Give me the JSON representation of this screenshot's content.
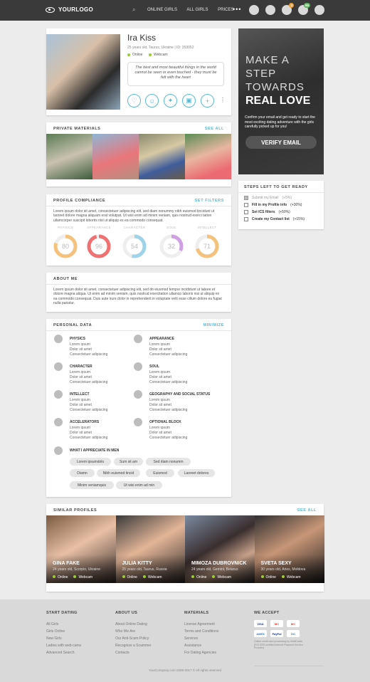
{
  "header": {
    "logo": "YOURLOGO",
    "nav": [
      "ONLINE GIRLS",
      "ALL GIRLS",
      "PRICES"
    ],
    "more": "•••",
    "badges": {
      "notifications": "3",
      "credits": "65"
    }
  },
  "profile": {
    "name": "Ira Kiss",
    "meta": "25 years old, Taurus, Ukraine | ID: 353052",
    "status_online": "Online",
    "status_webcam": "Webcam",
    "quote": "The best and most beautiful things in the world cannot be seen or even touched - they must be felt with the heart"
  },
  "private": {
    "title": "PRIVATE MATERIALS",
    "link": "SEE ALL"
  },
  "compliance": {
    "title": "PROFILE COMPLIANCE",
    "link": "SET FILTERS",
    "text": "Lorem ipsum dolor sit amet, consectetuer adipiscing elit, sed diam nonummy nibh euismod tincidunt ut laoreet dolore magna aliquam erat volutpat. Ut wisi enim ad minim veniam, quis nostrud exerci tation ullamcorper suscipit lobortis nisl ut aliquip ex ea commodo consequat.",
    "metrics": [
      {
        "label": "PHYSICS",
        "value": "80",
        "pct": 80,
        "color": "#f4c27c"
      },
      {
        "label": "APPEARANCE",
        "value": "96",
        "pct": 96,
        "color": "#f07171"
      },
      {
        "label": "CHARACTER",
        "value": "54",
        "pct": 54,
        "color": "#9fd3ea"
      },
      {
        "label": "SOUL",
        "value": "32",
        "pct": 32,
        "color": "#cfa0e4"
      },
      {
        "label": "INTELLECT",
        "value": "71",
        "pct": 71,
        "color": "#f4c27c"
      }
    ]
  },
  "about": {
    "title": "ABOUT ME",
    "text": "Lorem ipsum dolor sit amet, consectetuer adipiscing elit, sed do eiusmod tempor incididunt ut labore et dolore magna aliqua. Ut enim ad minim veniam, quis nostrud exercitation ullamco laboris nisi ut aliquip ex ea commodo consequat. Duis aute irure dolor in reprehenderit in voluptate velit esse cillum dolore eu fugiat nulla pariatur."
  },
  "personal": {
    "title": "PERSONAL DATA",
    "link": "MINIMIZE",
    "blocks": [
      {
        "head": "PHYSICS",
        "l1": "Lorem ipsum",
        "l2": "Dolor sit amet",
        "l3": "Consectetuer adipiscing"
      },
      {
        "head": "APPEARANCE",
        "l1": "Lorem ipsum",
        "l2": "Dolor sit amet",
        "l3": "Consectetuer adipiscing"
      },
      {
        "head": "CHARACTER",
        "l1": "Lorem ipsum",
        "l2": "Dolor sit amet",
        "l3": "Consectetuer adipiscing"
      },
      {
        "head": "SOUL",
        "l1": "Lorem ipsum",
        "l2": "Dolor sit amet",
        "l3": "Consectetuer adipiscing"
      },
      {
        "head": "INTELLECT",
        "l1": "Lorem ipsum",
        "l2": "Dolor sit amet",
        "l3": "Consectetuer adipiscing"
      },
      {
        "head": "GEOGRAPHY AND SOCIAL STATUS",
        "l1": "Lorem ipsum",
        "l2": "Dolor sit amet",
        "l3": "Consectetuer adipiscing"
      },
      {
        "head": "ACCELERATORS",
        "l1": "Lorem ipsum",
        "l2": "Dolor sit amet",
        "l3": "Consectetuer adipiscing"
      },
      {
        "head": "OPTIONAL BLOCK",
        "l1": "Lorem ipsum",
        "l2": "Dolor sit amet",
        "l3": "Consectetuer adipiscing"
      }
    ],
    "appreciate": "WHAT I APPRECIATE IN MEN",
    "tags": [
      "Lorem ipsumdolo",
      "Sum sit am",
      "Sed diam nonumm",
      "Diamn",
      "Nibh euismod tincid",
      "Euismod",
      "Laoreet dolores",
      "Minim veniamquis",
      "Ut wisi enim ad min"
    ]
  },
  "similar": {
    "title": "SIMILAR PROFILES",
    "link": "SEE ALL",
    "items": [
      {
        "name": "GINA FAKE",
        "sub": "24 years old, Scorpio, Ukraine",
        "online": "Online",
        "webcam": "Webcam"
      },
      {
        "name": "JULIA KITTY",
        "sub": "25 years old, Taurus, Russia",
        "online": "Online",
        "webcam": "Webcam"
      },
      {
        "name": "MIMOZA DUBROVNICK",
        "sub": "24 years old, Gemini, Belarus",
        "online": "Online",
        "webcam": "Webcam"
      },
      {
        "name": "SVETA SEXY",
        "sub": "30 years old, Aries, Moldova",
        "online": "Online",
        "webcam": "Webcam"
      }
    ]
  },
  "promo": {
    "l1": "MAKE A",
    "l2": "STEP",
    "l3": "TOWARDS",
    "l4": "REAL LOVE",
    "text": "Confirm your email and get ready to start the most exciting dating adventure with the girls carefully picked up for you!",
    "button": "VERIFY EMAIL"
  },
  "steps": {
    "title": "STEPS LEFT TO GET READY",
    "items": [
      {
        "label": "Submit my Email",
        "bonus": "(+5%)"
      },
      {
        "label": "Fill in my Profile info",
        "bonus": "(+30%)"
      },
      {
        "label": "Set ICS filters",
        "bonus": "(+50%)"
      },
      {
        "label": "Create my Contact list",
        "bonus": "(+15%)"
      }
    ]
  },
  "footer": {
    "c1": {
      "h": "START DATING",
      "links": [
        "All Girls",
        "Girls Online",
        "New Girls",
        "Ladies with web-cams",
        "Advanced Search"
      ]
    },
    "c2": {
      "h": "ABOUT US",
      "links": [
        "About Online Dating",
        "Who We Are",
        "Our Anti-Scam Policy",
        "Recognize a Scammer",
        "Contacts"
      ]
    },
    "c3": {
      "h": "MATERIALS",
      "links": [
        "License Agreement",
        "Terms and Conditions",
        "Services",
        "Assistance",
        "For Dating Agencies"
      ]
    },
    "c4": {
      "h": "WE ACCEPT",
      "note": "Online credit card processing by MultiCards (PCI DSS certified Internet Payment Service Provider)",
      "cards": [
        "VISA",
        "MC",
        "MC",
        "AMEX",
        "PayPal",
        "DC"
      ]
    },
    "copyright": "YourCompany.com 2009-2017 © All rights reserved"
  }
}
